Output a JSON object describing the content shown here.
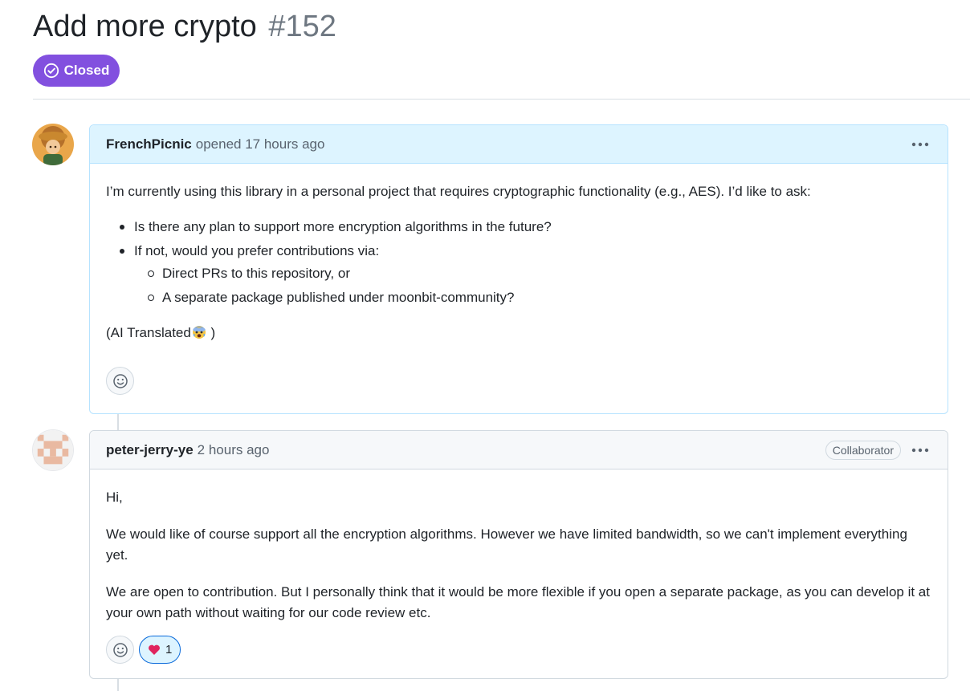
{
  "issue": {
    "title": "Add more crypto",
    "number": "#152",
    "state": "Closed",
    "state_color": "#8250df"
  },
  "comments": [
    {
      "author": "FrenchPicnic",
      "meta": "opened 17 hours ago",
      "menu_icon": "kebab-horizontal-icon",
      "body": {
        "intro": "I’m currently using this library in a personal project that requires cryptographic functionality (e.g., AES). I’d like to ask:",
        "bullets": [
          "Is there any plan to support more encryption algorithms in the future?",
          "If not, would you prefer contributions via:"
        ],
        "sub_bullets": [
          "Direct PRs to this repository, or",
          "A separate package published under moonbit-community?"
        ],
        "note_prefix": "(AI Translated",
        "note_suffix": " )"
      },
      "reactions": []
    },
    {
      "author": "peter-jerry-ye",
      "meta": "2 hours ago",
      "role": "Collaborator",
      "menu_icon": "kebab-horizontal-icon",
      "body": {
        "paragraphs": [
          "Hi,",
          "We would like of course support all the encryption algorithms. However we have limited bandwidth, so we can't implement everything yet.",
          "We are open to contribution. But I personally think that it would be more flexible if you open a separate package, as you can develop it at your own path without waiting for our code review etc."
        ]
      },
      "reactions": [
        {
          "emoji": "heart-icon",
          "count": "1"
        }
      ]
    }
  ],
  "colors": {
    "author_header_bg": "#ddf4ff",
    "header_bg": "#f6f8fa",
    "reaction_active_border": "#0969da"
  }
}
